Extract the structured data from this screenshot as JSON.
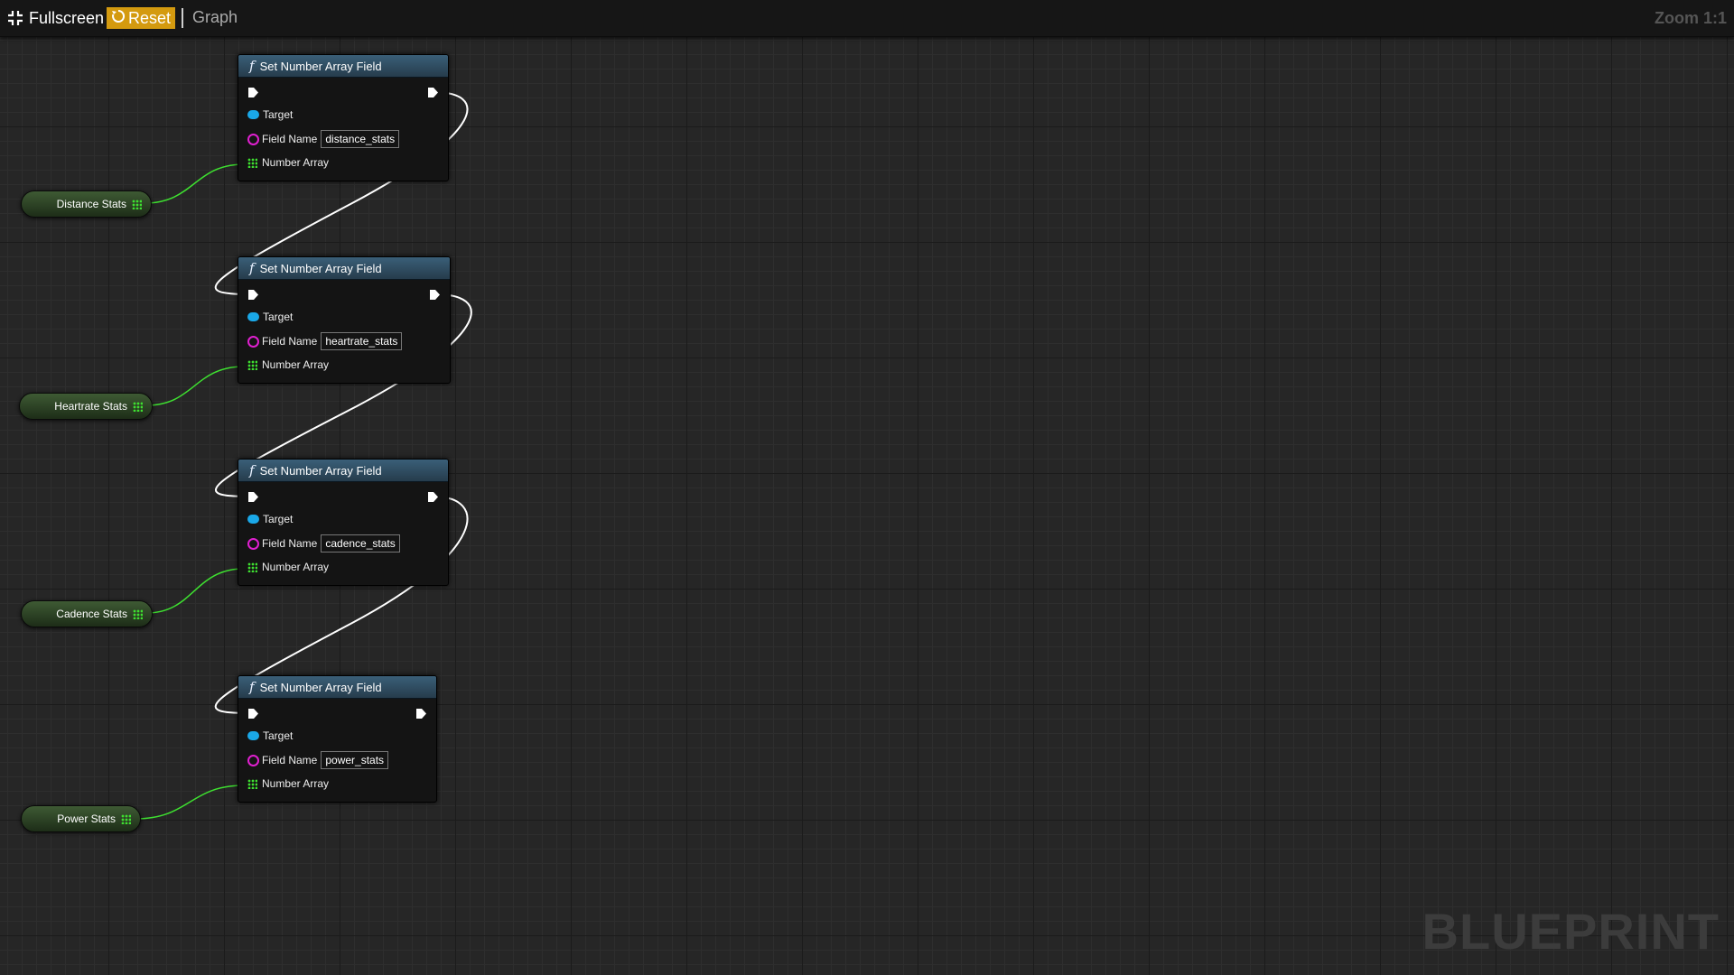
{
  "toolbar": {
    "fullscreen_label": "Fullscreen",
    "reset_label": "Reset",
    "graph_label": "Graph",
    "zoom_label": "Zoom 1:1"
  },
  "watermark": "BLUEPRINT",
  "colors": {
    "exec_wire": "#ffffff",
    "array_wire": "#3ee030",
    "target_pin": "#1aa8e8",
    "field_pin": "#e020d0",
    "reset_accent": "#d49a0f"
  },
  "nodes": [
    {
      "title": "Set Number Array Field",
      "target_label": "Target",
      "field_name_label": "Field Name",
      "field_value": "distance_stats",
      "array_label": "Number Array"
    },
    {
      "title": "Set Number Array Field",
      "target_label": "Target",
      "field_name_label": "Field Name",
      "field_value": "heartrate_stats",
      "array_label": "Number Array"
    },
    {
      "title": "Set Number Array Field",
      "target_label": "Target",
      "field_name_label": "Field Name",
      "field_value": "cadence_stats",
      "array_label": "Number Array"
    },
    {
      "title": "Set Number Array Field",
      "target_label": "Target",
      "field_name_label": "Field Name",
      "field_value": "power_stats",
      "array_label": "Number Array"
    }
  ],
  "variables": [
    {
      "label": "Distance Stats"
    },
    {
      "label": "Heartrate Stats"
    },
    {
      "label": "Cadence Stats"
    },
    {
      "label": "Power Stats"
    }
  ]
}
